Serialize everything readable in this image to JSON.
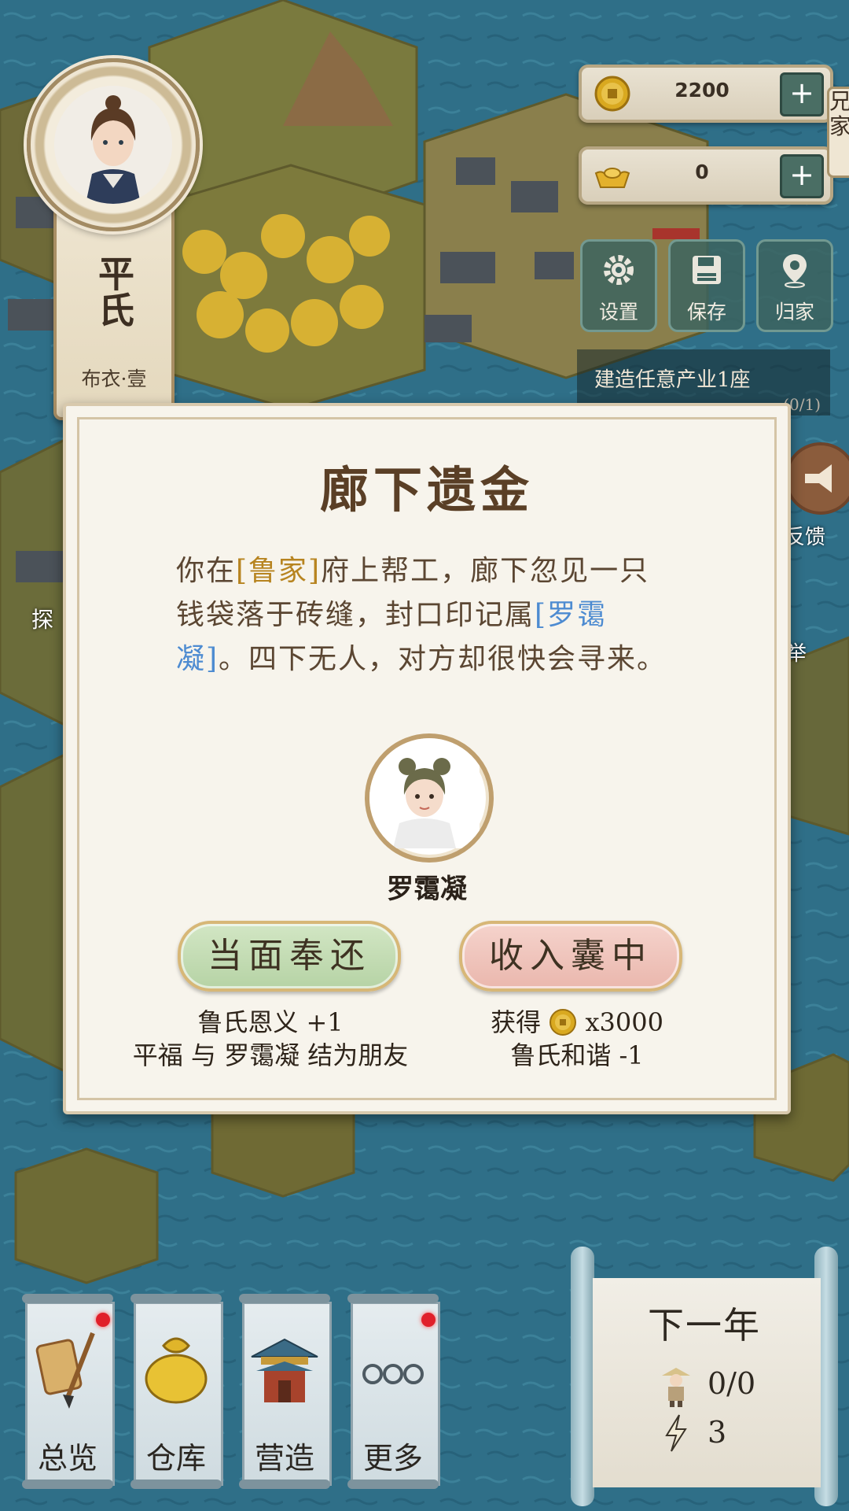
{
  "player": {
    "name": "平氏",
    "rank": "布衣·壹"
  },
  "resources": {
    "coins": "2200",
    "ingots": "0",
    "add_symbol": "+"
  },
  "system_buttons": {
    "settings": "设置",
    "save": "保存",
    "home": "归家"
  },
  "task": {
    "text": "建造任意产业1座",
    "progress": "(0/1)"
  },
  "side_edge_text": "兄家",
  "side_labels": {
    "feedback": "反馈",
    "report": "举",
    "explore": "探"
  },
  "event": {
    "title": "廊下遗金",
    "story_parts": [
      "你在",
      "[鲁家]",
      "府上帮工，廊下忽见一只钱袋落于砖缝，封口印记属",
      "[罗霭凝]",
      "。四下无人，对方却很快会寻来。"
    ],
    "npc_name": "罗霭凝",
    "choices": [
      {
        "label": "当面奉还",
        "effects": [
          "鲁氏恩义 +1",
          "平福 与 罗霭凝 结为朋友"
        ]
      },
      {
        "label": "收入囊中",
        "effects_prefix": "获得",
        "effects_amount": "x3000",
        "effects_line2": "鲁氏和谐 -1"
      }
    ]
  },
  "bottom_menu": [
    {
      "label": "总览",
      "badge": true
    },
    {
      "label": "仓库",
      "badge": false
    },
    {
      "label": "营造",
      "badge": false
    },
    {
      "label": "更多",
      "badge": true
    }
  ],
  "next_year": {
    "title": "下一年",
    "workers": "0/0",
    "energy": "3"
  },
  "colors": {
    "accent_gold": "#b78420",
    "accent_blue": "#4d8bd1",
    "badge_red": "#e0202a"
  }
}
